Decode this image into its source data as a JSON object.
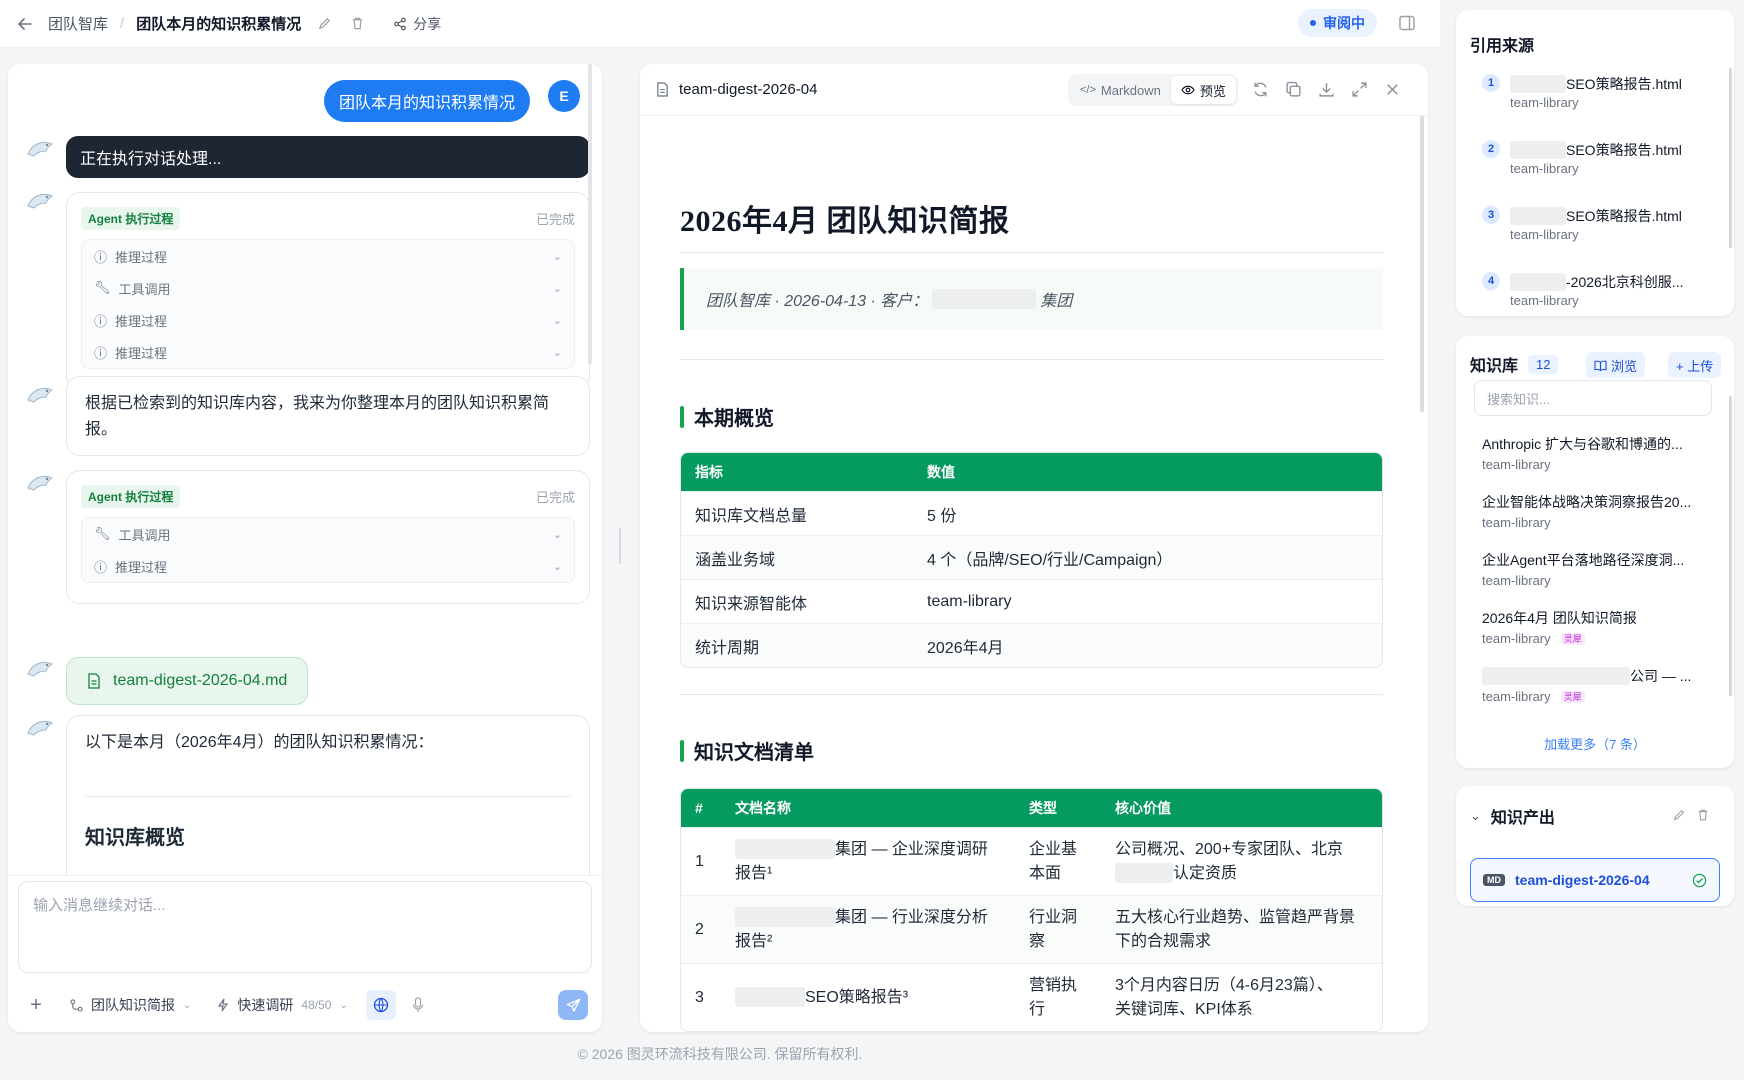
{
  "topbar": {
    "breadcrumb_root": "团队智库",
    "breadcrumb_sep": "/",
    "title": "团队本月的知识积累情况",
    "share": "分享",
    "status": "审阅中"
  },
  "chat": {
    "user_message": "团队本月的知识积累情况",
    "user_avatar": "E",
    "processing": "正在执行对话处理...",
    "agent_label": "Agent 执行过程",
    "done_label": "已完成",
    "steps_1": [
      "推理过程",
      "工具调用",
      "推理过程",
      "推理过程"
    ],
    "steps_2": [
      "工具调用",
      "推理过程"
    ],
    "reply_1": "根据已检索到的知识库内容，我来为你整理本月的团队知识积累简报。",
    "file_chip": "team-digest-2026-04.md",
    "reply_2": "以下是本月（2026年4月）的团队知识积累情况：",
    "reply_2_heading": "知识库概览",
    "composer_placeholder": "输入消息继续对话...",
    "toolbar": {
      "mode": "团队知识简报",
      "research": "快速调研",
      "quota": "48/50"
    }
  },
  "doc": {
    "filename": "team-digest-2026-04",
    "markdown_label": "Markdown",
    "preview_label": "预览",
    "title": "2026年4月 团队知识简报",
    "meta_prefix": "团队智库 · 2026-04-13 · 客户：",
    "meta_suffix": "集团",
    "section_1": "本期概览",
    "overview_headers": [
      "指标",
      "数值"
    ],
    "overview_rows": [
      [
        "知识库文档总量",
        "5 份"
      ],
      [
        "涵盖业务域",
        "4 个（品牌/SEO/行业/Campaign）"
      ],
      [
        "知识来源智能体",
        "team-library"
      ],
      [
        "统计周期",
        "2026年4月"
      ]
    ],
    "section_2": "知识文档清单",
    "list_headers": [
      "#",
      "文档名称",
      "类型",
      "核心价值"
    ],
    "list_rows": [
      {
        "n": "1",
        "name_a": "集团 — 企业深度调研",
        "name_b": "报告¹",
        "type_a": "企业基",
        "type_b": "本面",
        "value_a": "公司概况、200+专家团队、北京",
        "value_b": "认定资质"
      },
      {
        "n": "2",
        "name_a": "集团 — 行业深度分析",
        "name_b": "报告²",
        "type_a": "行业洞",
        "type_b": "察",
        "value_a": "五大核心行业趋势、监管趋严背景",
        "value_b": "下的合规需求"
      },
      {
        "n": "3",
        "name_a": "SEO策略报告³",
        "name_b": "",
        "type_a": "营销执",
        "type_b": "行",
        "value_a": "3个月内容日历（4-6月23篇）、",
        "value_b": "关键词库、KPI体系"
      }
    ]
  },
  "sources": {
    "title": "引用来源",
    "items": [
      {
        "n": "1",
        "name": "SEO策略报告.html",
        "sub": "team-library"
      },
      {
        "n": "2",
        "name": "SEO策略报告.html",
        "sub": "team-library"
      },
      {
        "n": "3",
        "name": "SEO策略报告.html",
        "sub": "team-library"
      },
      {
        "n": "4",
        "name": "-2026北京科创服...",
        "sub": "team-library"
      }
    ]
  },
  "kb": {
    "title": "知识库",
    "count": "12",
    "browse": "浏览",
    "upload": "+ 上传",
    "search_placeholder": "搜索知识...",
    "items": [
      {
        "name": "Anthropic 扩大与谷歌和博通的...",
        "sub": "team-library"
      },
      {
        "name": "企业智能体战略决策洞察报告20...",
        "sub": "team-library"
      },
      {
        "name": "企业Agent平台落地路径深度洞...",
        "sub": "team-library"
      },
      {
        "name": "2026年4月 团队知识简报",
        "sub": "team-library",
        "tag": "灵犀"
      },
      {
        "name": "公司 — ...",
        "sub": "team-library",
        "tag": "灵犀"
      }
    ],
    "load_more": "加载更多（7 条）"
  },
  "output": {
    "title": "知识产出",
    "badge": "MD",
    "item": "team-digest-2026-04"
  },
  "footer": "© 2026 图灵环流科技有限公司. 保留所有权利."
}
